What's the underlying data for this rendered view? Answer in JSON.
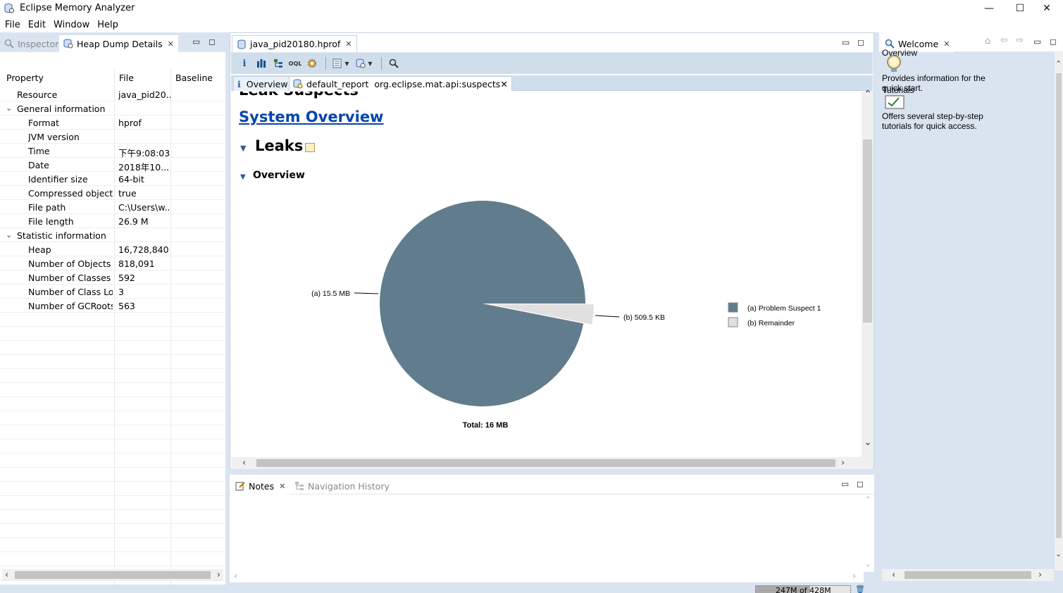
{
  "window": {
    "title": "Eclipse Memory Analyzer",
    "controls": {
      "minimize": "—",
      "maximize": "☐",
      "close": "✕"
    }
  },
  "menu": [
    "File",
    "Edit",
    "Window",
    "Help"
  ],
  "left_panel": {
    "tabs": [
      {
        "label": "Inspector",
        "icon": "inspector-icon",
        "active": false
      },
      {
        "label": "Heap Dump Details",
        "icon": "heap-dump-icon",
        "active": true
      }
    ],
    "columns": [
      "Property",
      "File",
      "Baseline"
    ],
    "rows": [
      {
        "level": 0,
        "property": "Resource",
        "file": "java_pid20..."
      },
      {
        "level": 0,
        "group": true,
        "property": "General information",
        "file": ""
      },
      {
        "level": 1,
        "property": "Format",
        "file": "hprof"
      },
      {
        "level": 1,
        "property": "JVM version",
        "file": ""
      },
      {
        "level": 1,
        "property": "Time",
        "file": "下午9:08:03"
      },
      {
        "level": 1,
        "property": "Date",
        "file": "2018年10..."
      },
      {
        "level": 1,
        "property": "Identifier size",
        "file": "64-bit"
      },
      {
        "level": 1,
        "property": "Compressed object p",
        "file": "true"
      },
      {
        "level": 1,
        "property": "File path",
        "file": "C:\\Users\\w..."
      },
      {
        "level": 1,
        "property": "File length",
        "file": "26.9 M"
      },
      {
        "level": 0,
        "group": true,
        "property": "Statistic information",
        "file": ""
      },
      {
        "level": 1,
        "property": "Heap",
        "file": "16,728,840"
      },
      {
        "level": 1,
        "property": "Number of Objects",
        "file": "818,091"
      },
      {
        "level": 1,
        "property": "Number of Classes",
        "file": "592"
      },
      {
        "level": 1,
        "property": "Number of Class Loa",
        "file": "3"
      },
      {
        "level": 1,
        "property": "Number of GCRoots",
        "file": "563"
      }
    ]
  },
  "editor": {
    "tab_label": "java_pid20180.hprof",
    "subtabs": [
      {
        "label": "Overview",
        "icon": "info-icon"
      },
      {
        "label": "default_report  org.eclipse.mat.api:suspects",
        "icon": "report-icon"
      }
    ],
    "report": {
      "clipped_heading": "Leak Suspects",
      "system_overview_link": "System Overview",
      "leaks_title": "Leaks",
      "overview_title": "Overview"
    }
  },
  "chart_data": {
    "type": "pie",
    "title": "",
    "slices": [
      {
        "label": "(a)  15.5 MB",
        "legend": "(a)  Problem Suspect 1",
        "value_kb": 15872,
        "color": "#617d8d"
      },
      {
        "label": "(b)  509.5 KB",
        "legend": "(b)  Remainder",
        "value_kb": 509.5,
        "color": "#e0e0e0"
      }
    ],
    "total_label": "Total: 16 MB",
    "legend_position": "right"
  },
  "bottom_panel": {
    "tabs": [
      {
        "label": "Notes",
        "icon": "notes-icon",
        "active": true
      },
      {
        "label": "Navigation History",
        "icon": "navigation-history-icon",
        "active": false
      }
    ]
  },
  "right_panel": {
    "tab_label": "Welcome",
    "items": [
      {
        "title": "Overview",
        "description": "Provides information for the quick start.",
        "icon": "overview-lightbulb-icon"
      },
      {
        "title": "Tutorials",
        "description": "Offers several step-by-step tutorials for quick access.",
        "icon": "tutorials-icon"
      }
    ]
  },
  "status": {
    "heap_text": "247M of 428M",
    "heap_used_fraction": 0.577
  }
}
